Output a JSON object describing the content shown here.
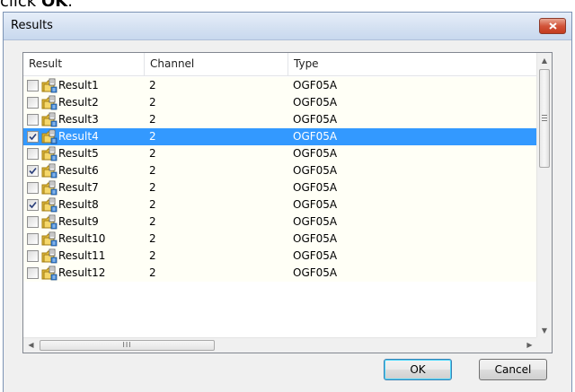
{
  "instruction": {
    "text_before": "click ",
    "bold": "OK",
    "text_after": "."
  },
  "window": {
    "title": "Results",
    "close_glyph": "x"
  },
  "list": {
    "columns": [
      "Result",
      "Channel",
      "Type"
    ],
    "rows": [
      {
        "name": "Result1",
        "channel": "2",
        "type": "OGF05A",
        "checked": false,
        "selected": false
      },
      {
        "name": "Result2",
        "channel": "2",
        "type": "OGF05A",
        "checked": false,
        "selected": false
      },
      {
        "name": "Result3",
        "channel": "2",
        "type": "OGF05A",
        "checked": false,
        "selected": false
      },
      {
        "name": "Result4",
        "channel": "2",
        "type": "OGF05A",
        "checked": true,
        "selected": true
      },
      {
        "name": "Result5",
        "channel": "2",
        "type": "OGF05A",
        "checked": false,
        "selected": false
      },
      {
        "name": "Result6",
        "channel": "2",
        "type": "OGF05A",
        "checked": true,
        "selected": false
      },
      {
        "name": "Result7",
        "channel": "2",
        "type": "OGF05A",
        "checked": false,
        "selected": false
      },
      {
        "name": "Result8",
        "channel": "2",
        "type": "OGF05A",
        "checked": true,
        "selected": false
      },
      {
        "name": "Result9",
        "channel": "2",
        "type": "OGF05A",
        "checked": false,
        "selected": false
      },
      {
        "name": "Result10",
        "channel": "2",
        "type": "OGF05A",
        "checked": false,
        "selected": false
      },
      {
        "name": "Result11",
        "channel": "2",
        "type": "OGF05A",
        "checked": false,
        "selected": false
      },
      {
        "name": "Result12",
        "channel": "2",
        "type": "OGF05A",
        "checked": false,
        "selected": false
      }
    ],
    "row_icon": "result-folder-icon",
    "hscroll_grip": "III"
  },
  "buttons": {
    "ok": "OK",
    "cancel": "Cancel"
  },
  "colors": {
    "selection": "#3399ff",
    "row_background": "#fffff6",
    "close_button": "#c43b1e"
  }
}
